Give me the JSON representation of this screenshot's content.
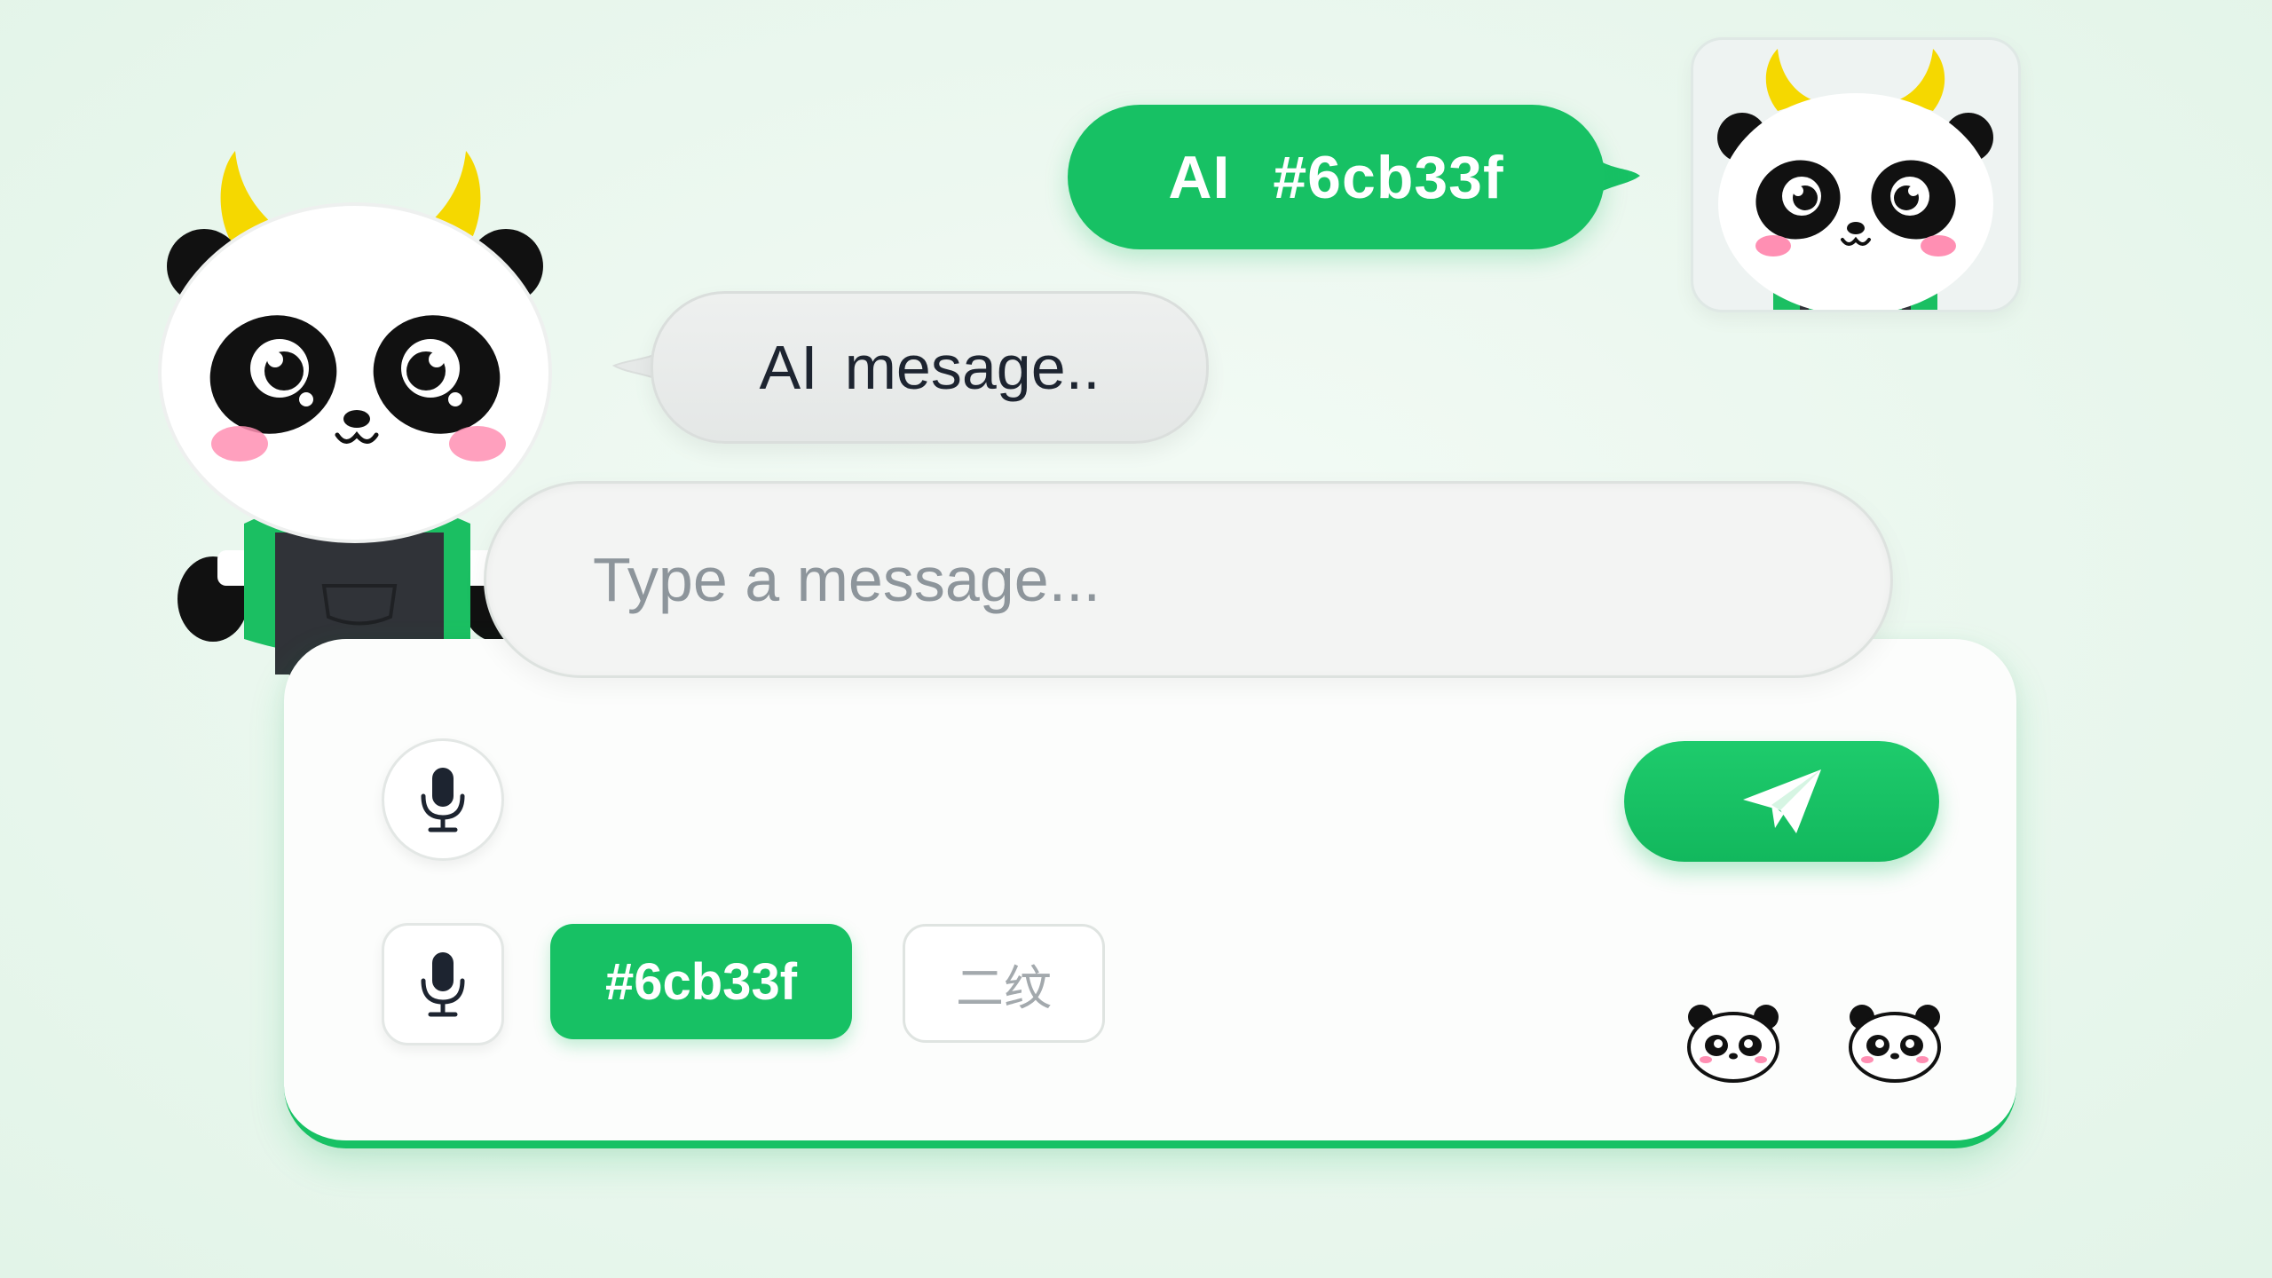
{
  "colors": {
    "accent": "#17c164",
    "text_dark": "#1d2430",
    "placeholder": "#8d959b"
  },
  "user_message": {
    "part1": "AI",
    "part2": "#6cb33f"
  },
  "ai_message": {
    "part1": "AI",
    "part2": "mesage.."
  },
  "composer": {
    "placeholder": "Type a message...",
    "chip_primary": "#6cb33f",
    "chip_secondary": "二纹"
  },
  "icons": {
    "mascot": "panda-mascot-icon",
    "avatar": "panda-avatar-icon",
    "mic": "microphone-icon",
    "send": "paper-plane-icon",
    "emoji": "panda-emoji-icon"
  }
}
